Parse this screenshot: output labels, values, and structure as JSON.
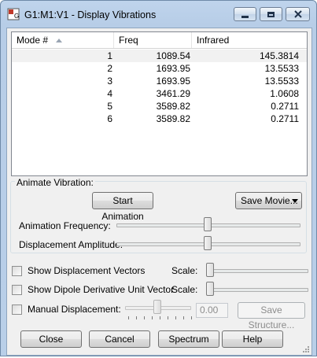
{
  "window": {
    "title": "G1:M1:V1 - Display Vibrations",
    "accent_color": "#bcd2ec",
    "controls": [
      "minimize-icon",
      "maximize-icon",
      "close-icon"
    ]
  },
  "modes_table": {
    "columns": [
      "Mode #",
      "Freq",
      "Infrared"
    ],
    "sort_column": "Mode #",
    "sort_direction": "ascending",
    "rows": [
      {
        "mode": "1",
        "freq": "1089.54",
        "infrared": "145.3814",
        "selected": true
      },
      {
        "mode": "2",
        "freq": "1693.95",
        "infrared": "13.5533"
      },
      {
        "mode": "3",
        "freq": "1693.95",
        "infrared": "13.5533"
      },
      {
        "mode": "4",
        "freq": "3461.29",
        "infrared": "1.0608"
      },
      {
        "mode": "5",
        "freq": "3589.82",
        "infrared": "0.2711"
      },
      {
        "mode": "6",
        "freq": "3589.82",
        "infrared": "0.2711"
      }
    ]
  },
  "animate": {
    "group_label": "Animate Vibration:",
    "start_button": "Start Animation",
    "save_movie_button": "Save Movie...",
    "frequency_label": "Animation Frequency:",
    "frequency_level": 0.5,
    "amplitude_label": "Displacement Amplitude:",
    "amplitude_level": 0.5
  },
  "options": {
    "show_vectors": {
      "label": "Show Displacement Vectors",
      "checked": false,
      "scale_label": "Scale:",
      "scale_level": 0.0
    },
    "show_dipole": {
      "label": "Show Dipole Derivative Unit Vector",
      "checked": false,
      "scale_label": "Scale:",
      "scale_level": 0.0
    },
    "manual": {
      "label": "Manual Displacement:",
      "checked": false,
      "value": "0.00",
      "save_structure_button": "Save Structure...",
      "slider_level": 0.5
    }
  },
  "footer": {
    "close": "Close",
    "cancel": "Cancel",
    "spectrum": "Spectrum",
    "help": "Help"
  }
}
